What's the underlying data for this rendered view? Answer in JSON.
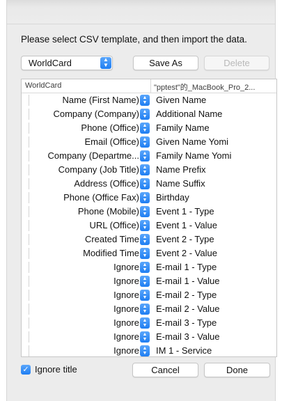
{
  "instruction": "Please select CSV template, and then import the data.",
  "template_select": {
    "value": "WorldCard"
  },
  "buttons": {
    "save_as": "Save As",
    "delete": "Delete",
    "cancel": "Cancel",
    "done": "Done"
  },
  "table": {
    "columns": [
      "WorldCard",
      "\"pptest\"的_MacBook_Pro_2..."
    ],
    "rows": [
      {
        "map": "Name (First Name)",
        "field": "Given Name"
      },
      {
        "map": "Company (Company)",
        "field": "Additional Name"
      },
      {
        "map": "Phone (Office)",
        "field": "Family Name"
      },
      {
        "map": "Email (Office)",
        "field": "Given Name Yomi"
      },
      {
        "map": "Company (Departme...",
        "field": "Family Name Yomi"
      },
      {
        "map": "Company (Job Title)",
        "field": "Name Prefix"
      },
      {
        "map": "Address (Office)",
        "field": "Name Suffix"
      },
      {
        "map": "Phone (Office Fax)",
        "field": "Birthday"
      },
      {
        "map": "Phone (Mobile)",
        "field": "Event 1 - Type"
      },
      {
        "map": "URL (Office)",
        "field": "Event 1 - Value"
      },
      {
        "map": "Created Time",
        "field": "Event 2 - Type"
      },
      {
        "map": "Modified Time",
        "field": "Event 2 - Value"
      },
      {
        "map": "Ignore",
        "field": "E-mail 1 - Type"
      },
      {
        "map": "Ignore",
        "field": "E-mail 1 - Value"
      },
      {
        "map": "Ignore",
        "field": "E-mail 2 - Type"
      },
      {
        "map": "Ignore",
        "field": "E-mail 2 - Value"
      },
      {
        "map": "Ignore",
        "field": "E-mail 3 - Type"
      },
      {
        "map": "Ignore",
        "field": "E-mail 3 - Value"
      },
      {
        "map": "Ignore",
        "field": "IM 1 - Service"
      }
    ]
  },
  "ignore_title": {
    "label": "Ignore title",
    "checked": true
  },
  "colors": {
    "accent": "#1f7ef2",
    "dialog_bg": "#ececec"
  },
  "icons": {
    "stepper": "chevron-updown-icon",
    "check": "checkmark-icon"
  }
}
